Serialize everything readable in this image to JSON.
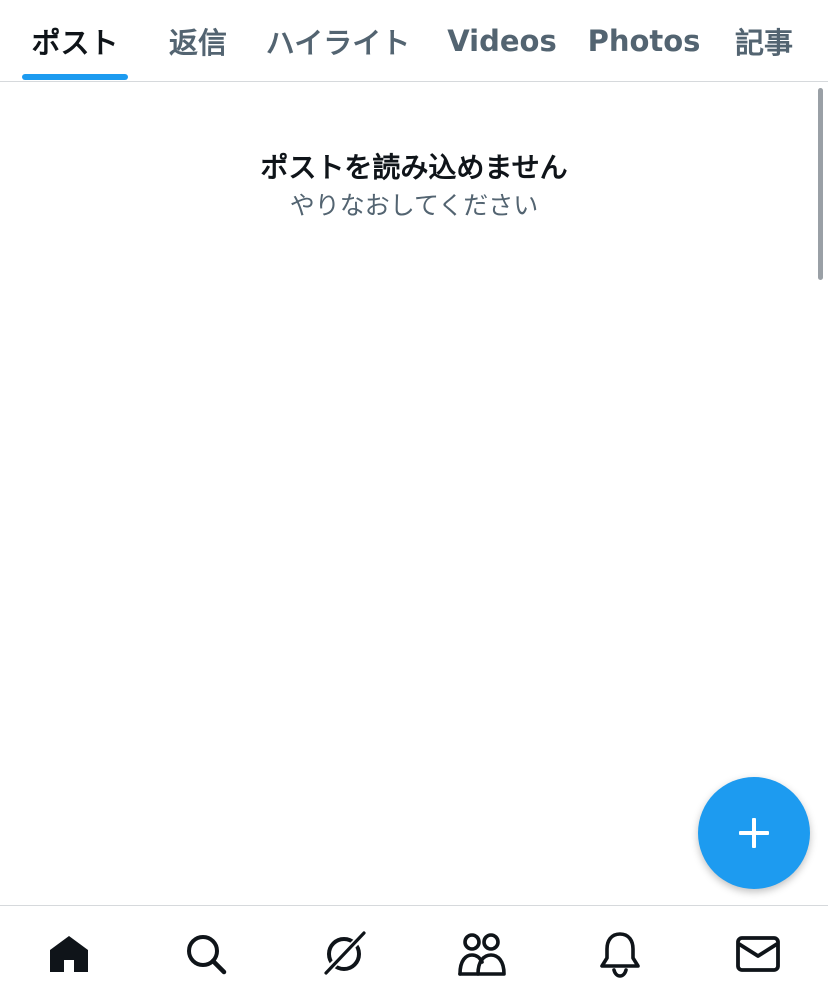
{
  "tabs": {
    "items": [
      {
        "label": "ポスト",
        "active": true
      },
      {
        "label": "返信",
        "active": false
      },
      {
        "label": "ハイライト",
        "active": false
      },
      {
        "label": "Videos",
        "active": false
      },
      {
        "label": "Photos",
        "active": false
      },
      {
        "label": "記事",
        "active": false
      }
    ],
    "indicator_color": "#1d9bf0"
  },
  "empty_state": {
    "title": "ポストを読み込めません",
    "subtitle": "やりなおしてください"
  },
  "fab": {
    "icon": "plus-icon",
    "color": "#1d9bf0"
  },
  "bottom_nav": {
    "items": [
      {
        "icon": "home-icon",
        "active": true
      },
      {
        "icon": "search-icon",
        "active": false
      },
      {
        "icon": "grok-icon",
        "active": false
      },
      {
        "icon": "communities-icon",
        "active": false
      },
      {
        "icon": "bell-icon",
        "active": false
      },
      {
        "icon": "mail-icon",
        "active": false
      }
    ]
  }
}
